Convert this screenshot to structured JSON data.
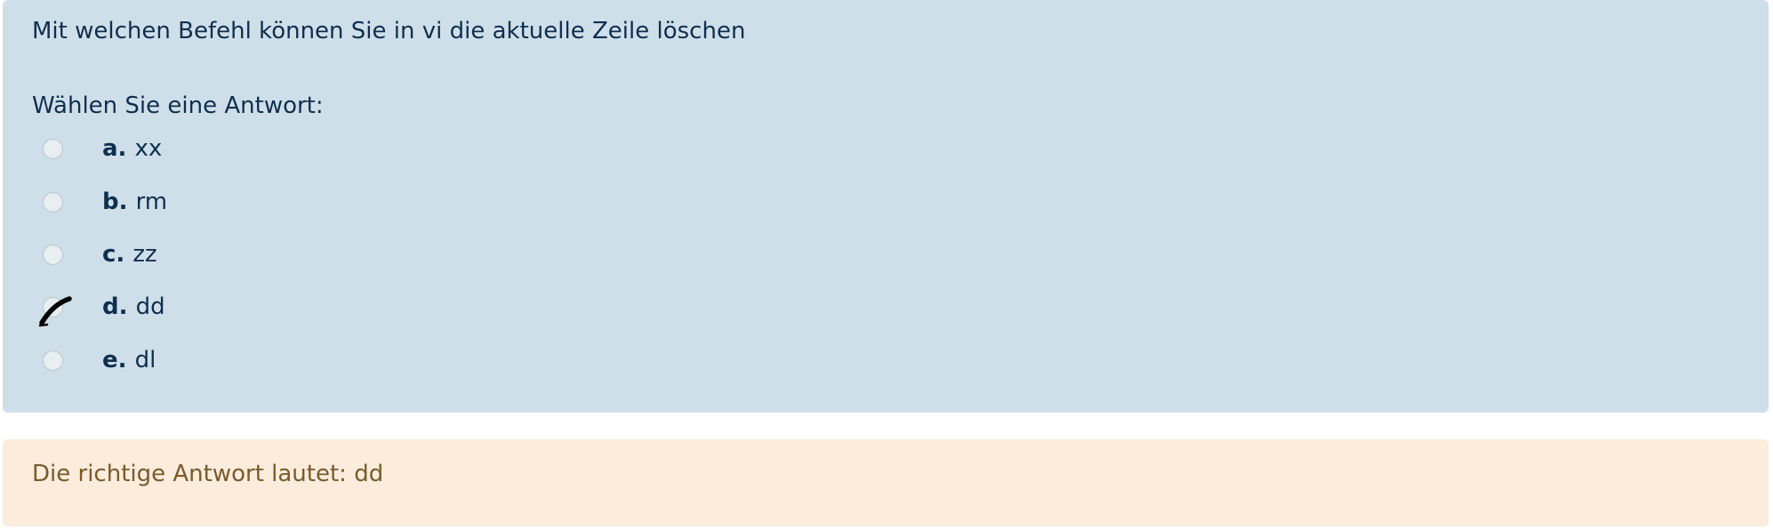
{
  "question": {
    "text": "Mit welchen Befehl können Sie in vi die aktuelle Zeile löschen",
    "prompt": "Wählen Sie eine Antwort:"
  },
  "answers": [
    {
      "letter": "a.",
      "value": "xx",
      "selected": false
    },
    {
      "letter": "b.",
      "value": "rm",
      "selected": false
    },
    {
      "letter": "c.",
      "value": "zz",
      "selected": false
    },
    {
      "letter": "d.",
      "value": "dd",
      "selected": true
    },
    {
      "letter": "e.",
      "value": "dl",
      "selected": false
    }
  ],
  "feedback": {
    "text": "Die richtige Antwort lautet: dd"
  },
  "colors": {
    "question_bg": "#cfdfea",
    "question_text": "#0f2f4f",
    "feedback_bg": "#fbecdc",
    "feedback_text": "#7a5a2a"
  },
  "icons": {
    "selected_mark": "checkmark-icon"
  }
}
